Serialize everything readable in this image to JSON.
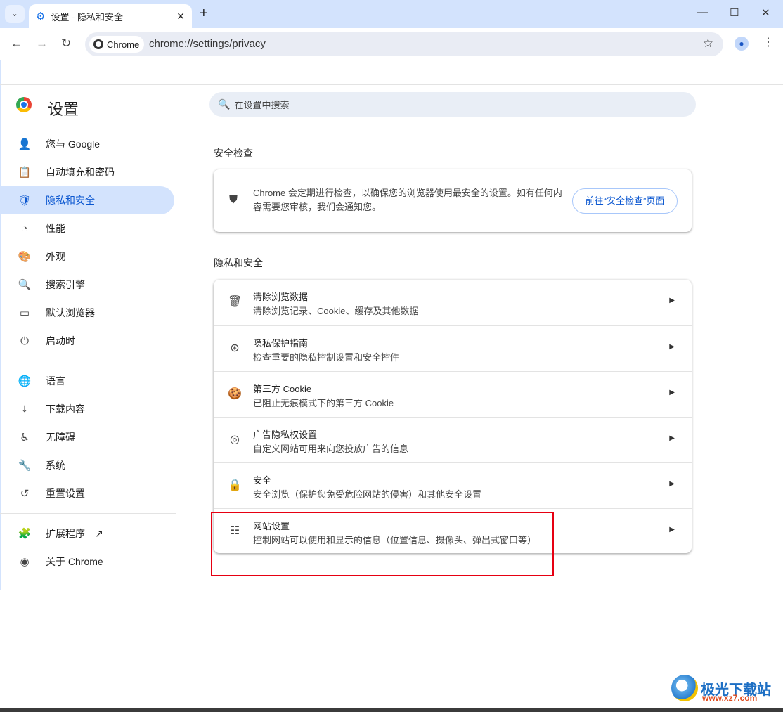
{
  "tab": {
    "title": "设置 - 隐私和安全"
  },
  "toolbar": {
    "chip": "Chrome",
    "url": "chrome://settings/privacy"
  },
  "app": {
    "title": "设置"
  },
  "sidebar": {
    "items": [
      {
        "label": "您与 Google",
        "icon": "person-icon",
        "glyph": "👤"
      },
      {
        "label": "自动填充和密码",
        "icon": "clipboard-icon",
        "glyph": "📋"
      },
      {
        "label": "隐私和安全",
        "icon": "shield-icon",
        "glyph": "🛡",
        "selected": true
      },
      {
        "label": "性能",
        "icon": "speedometer-icon",
        "glyph": "◔"
      },
      {
        "label": "外观",
        "icon": "palette-icon",
        "glyph": "🎨"
      },
      {
        "label": "搜索引擎",
        "icon": "search-icon",
        "glyph": "🔍"
      },
      {
        "label": "默认浏览器",
        "icon": "browser-icon",
        "glyph": "▭"
      },
      {
        "label": "启动时",
        "icon": "power-icon",
        "glyph": "⏻"
      },
      {
        "label": "语言",
        "icon": "globe-icon",
        "glyph": "🌐"
      },
      {
        "label": "下载内容",
        "icon": "download-icon",
        "glyph": "⤓"
      },
      {
        "label": "无障碍",
        "icon": "accessibility-icon",
        "glyph": "♿"
      },
      {
        "label": "系统",
        "icon": "wrench-icon",
        "glyph": "🔧"
      },
      {
        "label": "重置设置",
        "icon": "history-icon",
        "glyph": "↺"
      },
      {
        "label": "扩展程序",
        "icon": "puzzle-icon",
        "glyph": "🧩"
      },
      {
        "label": "关于 Chrome",
        "icon": "chrome-icon",
        "glyph": "◉"
      }
    ]
  },
  "search": {
    "placeholder": "在设置中搜索"
  },
  "safety": {
    "heading": "安全检查",
    "text": "Chrome 会定期进行检查，以确保您的浏览器使用最安全的设置。如有任何内容需要您审核，我们会通知您。",
    "button": "前往“安全检查”页面"
  },
  "privacy": {
    "heading": "隐私和安全",
    "rows": [
      {
        "title": "清除浏览数据",
        "sub": "清除浏览记录、Cookie、缓存及其他数据",
        "icon": "trash-icon",
        "glyph": "🗑"
      },
      {
        "title": "隐私保护指南",
        "sub": "检查重要的隐私控制设置和安全控件",
        "icon": "compass-icon",
        "glyph": "⊛"
      },
      {
        "title": "第三方 Cookie",
        "sub": "已阻止无痕模式下的第三方 Cookie",
        "icon": "cookie-icon",
        "glyph": "🍪"
      },
      {
        "title": "广告隐私权设置",
        "sub": "自定义网站可用来向您投放广告的信息",
        "icon": "ad-privacy-icon",
        "glyph": "◎"
      },
      {
        "title": "安全",
        "sub": "安全浏览（保护您免受危险网站的侵害）和其他安全设置",
        "icon": "lock-icon",
        "glyph": "🔒"
      },
      {
        "title": "网站设置",
        "sub": "控制网站可以使用和显示的信息（位置信息、摄像头、弹出式窗口等）",
        "icon": "tune-icon",
        "glyph": "☷"
      }
    ]
  },
  "watermark": {
    "name": "极光下载站",
    "url": "www.xz7.com"
  },
  "colors": {
    "accent": "#0b57d0",
    "selected_bg": "#d3e3fd",
    "highlight": "#e60012"
  }
}
